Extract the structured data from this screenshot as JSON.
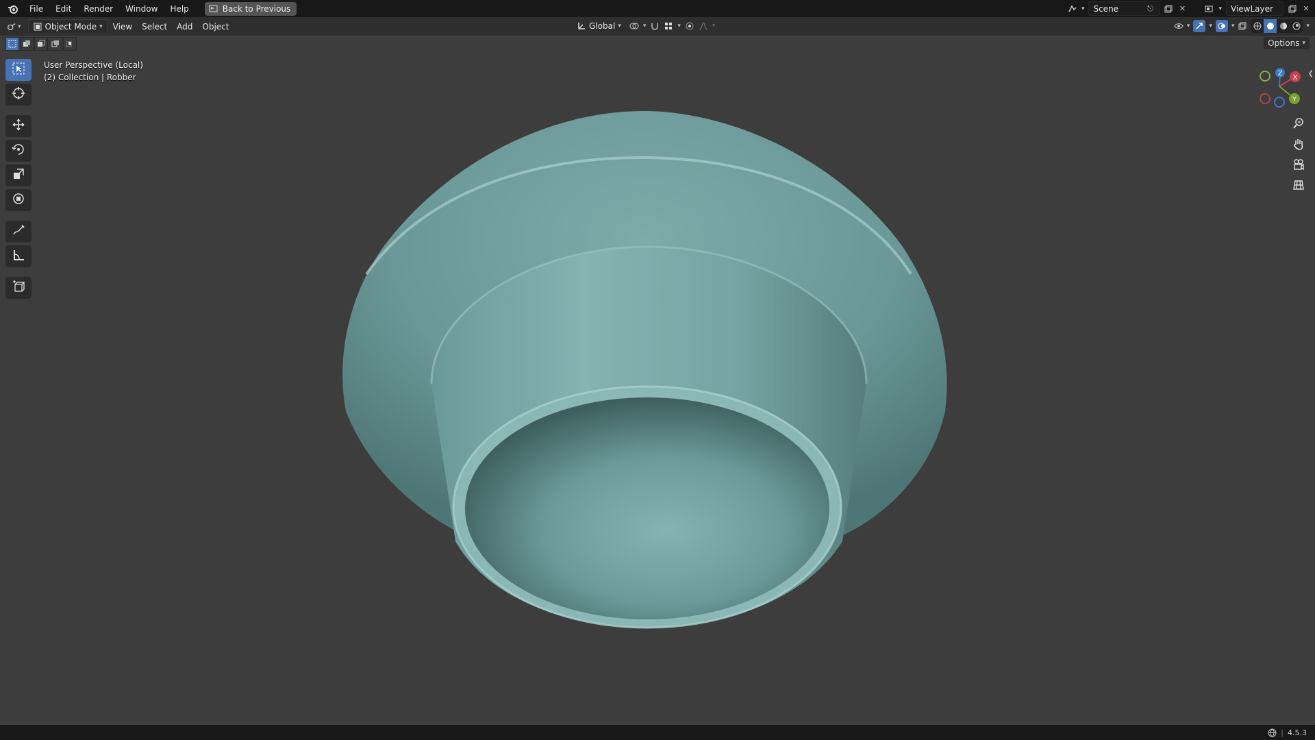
{
  "topbar": {
    "menu": [
      "File",
      "Edit",
      "Render",
      "Window",
      "Help"
    ],
    "back_button": "Back to Previous",
    "scene_name": "Scene",
    "view_layer": "ViewLayer"
  },
  "header": {
    "mode": "Object Mode",
    "menus": [
      "View",
      "Select",
      "Add",
      "Object"
    ],
    "transform_orientation": "Global",
    "options": "Options"
  },
  "viewport": {
    "perspective_label": "User Perspective (Local)",
    "collection_label": "(2) Collection | Robber",
    "object_color": "#6f9f9c",
    "background_color": "#3d3d3d"
  },
  "gizmo": {
    "x_label": "X",
    "y_label": "Y",
    "z_label": "Z"
  },
  "statusbar": {
    "version": "4.5.3"
  },
  "icons": {
    "toolbar": [
      "select-box-icon",
      "cursor-icon",
      "move-icon",
      "rotate-icon",
      "scale-icon",
      "transform-icon",
      "annotate-icon",
      "measure-icon",
      "add-cube-icon"
    ],
    "navigation": [
      "zoom-icon",
      "pan-hand-icon",
      "camera-icon",
      "grid-icon"
    ]
  }
}
